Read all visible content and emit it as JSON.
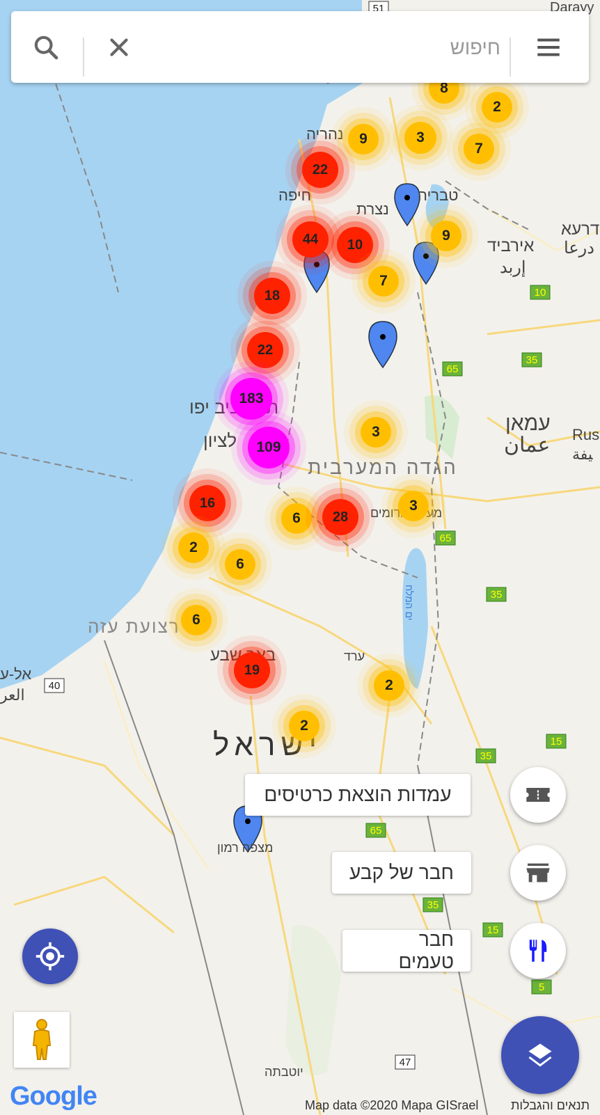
{
  "search": {
    "placeholder": "חיפוש"
  },
  "map": {
    "country_label": "ישראל",
    "place_labels": [
      {
        "key": "nahariya",
        "text": "נהריה"
      },
      {
        "key": "haifa",
        "text": "חיפה"
      },
      {
        "key": "tiberias",
        "text": "טבריה"
      },
      {
        "key": "nazareth",
        "text": "נצרת"
      },
      {
        "key": "irbid_he",
        "text": "אירביד"
      },
      {
        "key": "irbid_ar",
        "text": "إربد"
      },
      {
        "key": "daraa_he",
        "text": "דרעא"
      },
      {
        "key": "daraa_ar",
        "text": "درعا"
      },
      {
        "key": "telaviv",
        "text": "תל אביב יפו"
      },
      {
        "key": "rishon",
        "text": "לציון"
      },
      {
        "key": "westbank",
        "text": "הגדה המערבית"
      },
      {
        "key": "amman_he",
        "text": "עמאן"
      },
      {
        "key": "amman_ar",
        "text": "عمان"
      },
      {
        "key": "maale",
        "text": "מעלה אדומים"
      },
      {
        "key": "gaza",
        "text": "רצועת עזה"
      },
      {
        "key": "beersheba",
        "text": "באר שבע"
      },
      {
        "key": "arad",
        "text": "ערד"
      },
      {
        "key": "mitzpe",
        "text": "מצפה רמון"
      },
      {
        "key": "yotvata",
        "text": "יוטבתה"
      },
      {
        "key": "deadsea",
        "text": "ים המלח"
      },
      {
        "key": "darayya",
        "text": "Darayy"
      },
      {
        "key": "rus",
        "text": "Rus"
      },
      {
        "key": "al_arish",
        "text": "אל-ע"
      },
      {
        "key": "al_arish_ar",
        "text": "العر"
      },
      {
        "key": "sfa",
        "text": "ﻴﻔﺔ"
      }
    ],
    "road_shields": [
      "51",
      "65",
      "35",
      "10",
      "65",
      "35",
      "15",
      "35",
      "65",
      "35",
      "15",
      "5",
      "40",
      "47"
    ],
    "clusters": [
      {
        "count": "8",
        "level": "yellow"
      },
      {
        "count": "2",
        "level": "yellow"
      },
      {
        "count": "9",
        "level": "yellow"
      },
      {
        "count": "3",
        "level": "yellow"
      },
      {
        "count": "7",
        "level": "yellow"
      },
      {
        "count": "22",
        "level": "red"
      },
      {
        "count": "44",
        "level": "red"
      },
      {
        "count": "10",
        "level": "red"
      },
      {
        "count": "9",
        "level": "yellow"
      },
      {
        "count": "7",
        "level": "yellow"
      },
      {
        "count": "18",
        "level": "red"
      },
      {
        "count": "22",
        "level": "red"
      },
      {
        "count": "183",
        "level": "magenta"
      },
      {
        "count": "109",
        "level": "magenta"
      },
      {
        "count": "3",
        "level": "yellow"
      },
      {
        "count": "16",
        "level": "red"
      },
      {
        "count": "6",
        "level": "yellow"
      },
      {
        "count": "28",
        "level": "red"
      },
      {
        "count": "3",
        "level": "yellow"
      },
      {
        "count": "2",
        "level": "yellow"
      },
      {
        "count": "6",
        "level": "yellow"
      },
      {
        "count": "6",
        "level": "yellow"
      },
      {
        "count": "19",
        "level": "red"
      },
      {
        "count": "2",
        "level": "yellow"
      },
      {
        "count": "2",
        "level": "yellow"
      }
    ]
  },
  "actions": {
    "tickets": "עמדות הוצאת כרטיסים",
    "friend": "חבר של קבע",
    "taste": "חבר טעמים"
  },
  "footer": {
    "google": "Google",
    "map_data": "Map data ©2020 Mapa GISrael",
    "terms": "תנאים והגבלות"
  },
  "colors": {
    "accent": "#3f51b5",
    "sea": "#a6d3f2",
    "land": "#f3f1ec",
    "yellow_cluster": "#ffbf00",
    "red_cluster": "#ff2200",
    "magenta_cluster": "#ff00ff",
    "pin": "#4f86f0"
  },
  "icons": [
    "search-icon",
    "close-icon",
    "menu-icon",
    "ticket-icon",
    "store-icon",
    "restaurant-icon",
    "my-location-icon",
    "pegman-icon",
    "layers-icon",
    "map-pin-icon"
  ]
}
